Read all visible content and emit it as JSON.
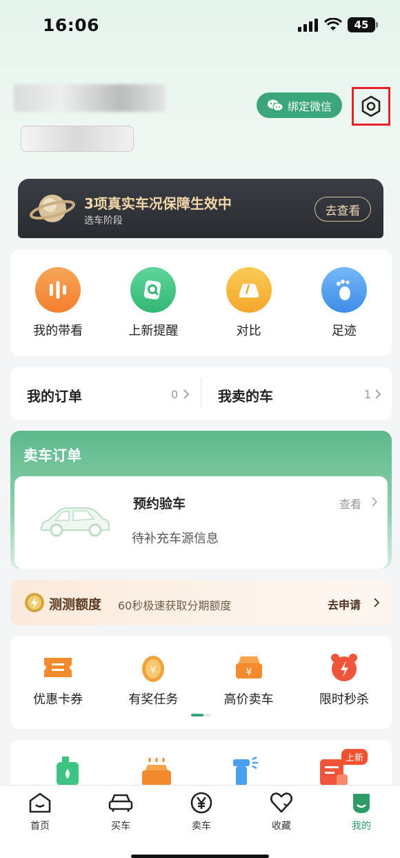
{
  "status_bar": {
    "time": "16:06",
    "battery": "45"
  },
  "profile": {
    "bind_wechat": "绑定微信"
  },
  "banner": {
    "title": "3项真实车况保障生效中",
    "subtitle": "选车阶段",
    "button": "去查看"
  },
  "quick_actions": [
    {
      "label": "我的带看",
      "icon": "audio-bars-icon",
      "color": "#f5923e"
    },
    {
      "label": "上新提醒",
      "icon": "new-search-icon",
      "color": "#3ec482"
    },
    {
      "label": "对比",
      "icon": "car-compare-icon",
      "color": "#f7b93a"
    },
    {
      "label": "足迹",
      "icon": "footprint-icon",
      "color": "#4a9ff0"
    }
  ],
  "orders": {
    "my_orders": {
      "label": "我的订单",
      "count": "0"
    },
    "my_sold_cars": {
      "label": "我卖的车",
      "count": "1"
    }
  },
  "sell_order": {
    "title": "卖车订单",
    "status": "预约验车",
    "view": "查看",
    "desc": "待补充车源信息"
  },
  "loan": {
    "title": "测测额度",
    "desc": "60秒极速获取分期额度",
    "action": "去申请"
  },
  "services": [
    {
      "label": "优惠卡券",
      "icon": "coupon-icon"
    },
    {
      "label": "有奖任务",
      "icon": "coin-icon"
    },
    {
      "label": "高价卖车",
      "icon": "sell-car-icon"
    },
    {
      "label": "限时秒杀",
      "icon": "alarm-icon"
    }
  ],
  "more_badge": "上新",
  "tabs": [
    {
      "label": "首页",
      "icon": "home-icon"
    },
    {
      "label": "买车",
      "icon": "car-icon"
    },
    {
      "label": "卖车",
      "icon": "yen-icon"
    },
    {
      "label": "收藏",
      "icon": "heart-icon"
    },
    {
      "label": "我的",
      "icon": "profile-icon",
      "active": true
    }
  ],
  "colors": {
    "accent": "#3aa67a",
    "highlight_box": "#e8202b"
  }
}
